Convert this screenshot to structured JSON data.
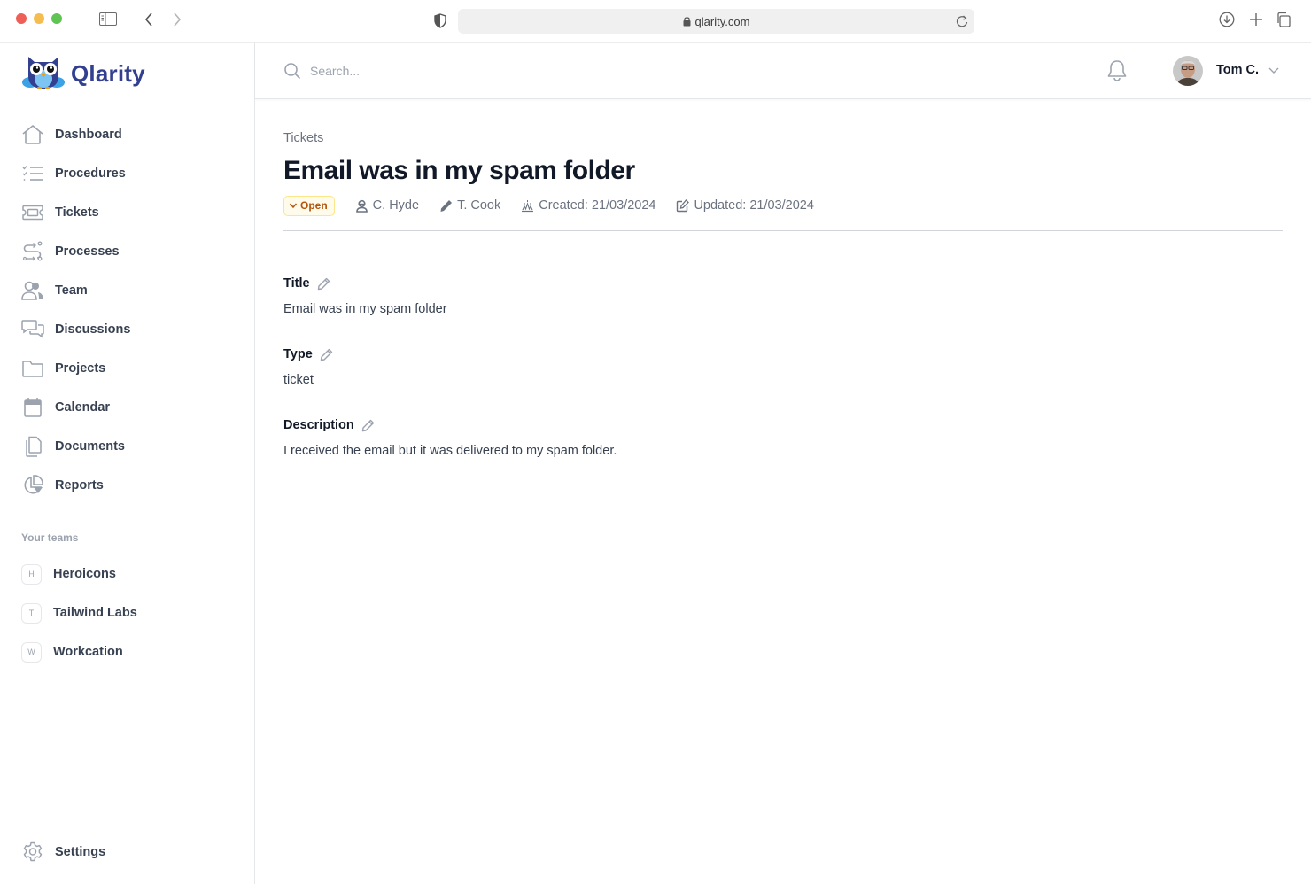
{
  "browser": {
    "url": "qlarity.com"
  },
  "brand": {
    "name": "Qlarity",
    "color": "#33408f"
  },
  "sidebar": {
    "items": [
      {
        "label": "Dashboard",
        "icon": "home-icon"
      },
      {
        "label": "Procedures",
        "icon": "checklist-icon"
      },
      {
        "label": "Tickets",
        "icon": "ticket-icon"
      },
      {
        "label": "Processes",
        "icon": "route-icon"
      },
      {
        "label": "Team",
        "icon": "users-icon"
      },
      {
        "label": "Discussions",
        "icon": "chat-bubbles-icon"
      },
      {
        "label": "Projects",
        "icon": "folder-icon"
      },
      {
        "label": "Calendar",
        "icon": "calendar-icon"
      },
      {
        "label": "Documents",
        "icon": "documents-icon"
      },
      {
        "label": "Reports",
        "icon": "pie-chart-icon"
      }
    ],
    "teams_heading": "Your teams",
    "teams": [
      {
        "initial": "H",
        "name": "Heroicons"
      },
      {
        "initial": "T",
        "name": "Tailwind Labs"
      },
      {
        "initial": "W",
        "name": "Workcation"
      }
    ],
    "settings_label": "Settings"
  },
  "topbar": {
    "search_placeholder": "Search...",
    "search_value": "",
    "user_name": "Tom C."
  },
  "ticket": {
    "breadcrumb": "Tickets",
    "title": "Email was in my spam folder",
    "status": "Open",
    "status_color": "#b45309",
    "assignee": "C. Hyde",
    "reporter": "T. Cook",
    "created": "Created: 21/03/2024",
    "updated": "Updated: 21/03/2024",
    "fields": [
      {
        "label": "Title",
        "value": "Email was in my spam folder"
      },
      {
        "label": "Type",
        "value": "ticket"
      },
      {
        "label": "Description",
        "value": "I received the email but it was delivered to my spam folder."
      }
    ]
  }
}
